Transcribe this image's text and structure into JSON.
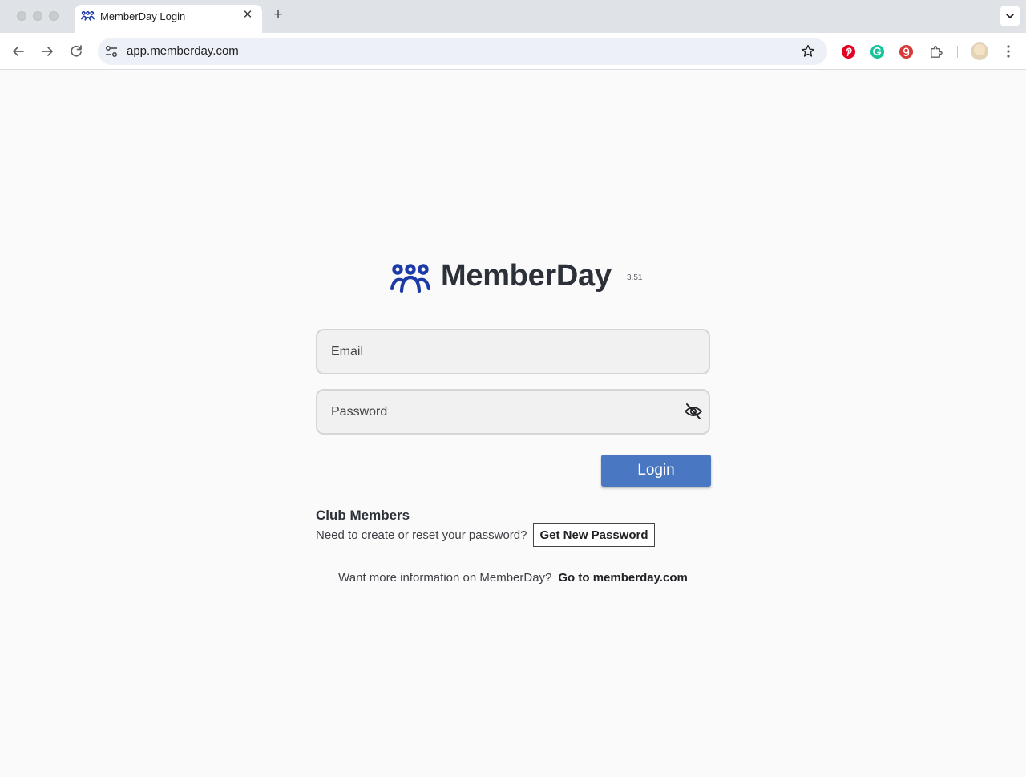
{
  "browser": {
    "tab": {
      "title": "MemberDay Login",
      "close_glyph": "✕",
      "favicon": "memberday-people-icon"
    },
    "new_tab_glyph": "+",
    "address_bar": {
      "url": "app.memberday.com"
    },
    "extensions": [
      {
        "name": "pinterest-extension-icon",
        "color": "#e60023"
      },
      {
        "name": "grammarly-extension-icon",
        "color": "#15c39a"
      },
      {
        "name": "g-extension-icon",
        "color": "#d93838"
      },
      {
        "name": "extensions-puzzle-icon",
        "color": "#5f6368"
      }
    ]
  },
  "page": {
    "brand": {
      "name": "MemberDay",
      "version": "3.51",
      "color": "#1d3ba8"
    },
    "email": {
      "placeholder": "Email",
      "value": ""
    },
    "password": {
      "placeholder": "Password",
      "value": "",
      "toggle_icon": "eye-slash-icon"
    },
    "login_label": "Login",
    "club": {
      "title": "Club Members",
      "prompt": "Need to create or reset your password?",
      "button_label": "Get New Password"
    },
    "info": {
      "text": "Want more information on MemberDay?",
      "link_label": "Go to memberday.com"
    },
    "accent_color": "#4a77c2"
  }
}
